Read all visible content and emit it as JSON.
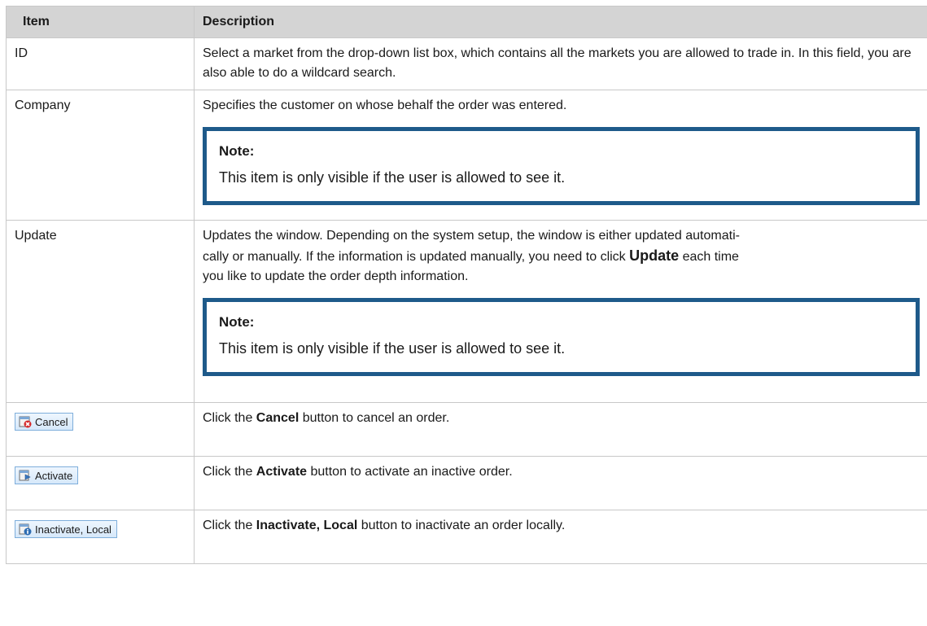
{
  "header": {
    "item": "Item",
    "description": "Description"
  },
  "rows": {
    "id": {
      "item": "ID",
      "desc": "Select a market from the drop-down list box, which contains all the markets you are allowed to trade in. In this field, you are also able to do a wildcard search."
    },
    "company": {
      "item": "Company",
      "desc": "Specifies the customer on whose behalf the order was entered.",
      "note_title": "Note:",
      "note_text": "This item is only visible if the user is allowed to see it."
    },
    "update": {
      "item": "Update",
      "desc_a": "Updates the window. Depending on the system setup, the window is either updated automati-",
      "desc_b": "cally or manually. If the information is updated manually, you need to click ",
      "desc_bold": "Update",
      "desc_c": " each time",
      "desc_d": "you like to update the order depth information.",
      "note_title": "Note:",
      "note_text": "This item is only visible if the user is allowed to see it."
    },
    "cancel": {
      "button_label": "Cancel",
      "icon": "cancel-icon",
      "desc_pre": "Click the ",
      "desc_bold": "Cancel",
      "desc_post": " button to cancel an order."
    },
    "activate": {
      "button_label": "Activate",
      "icon": "activate-icon",
      "desc_pre": "Click the ",
      "desc_bold": "Activate",
      "desc_post": " button to activate an inactive order."
    },
    "inactivate": {
      "button_label": "Inactivate, Local",
      "icon": "inactivate-local-icon",
      "desc_pre": "Click the ",
      "desc_bold": "Inactivate, Local",
      "desc_post": " button to inactivate an order locally."
    }
  },
  "colors": {
    "header_bg": "#d4d4d4",
    "note_border": "#1e5a8a",
    "button_border": "#7eaedb"
  }
}
